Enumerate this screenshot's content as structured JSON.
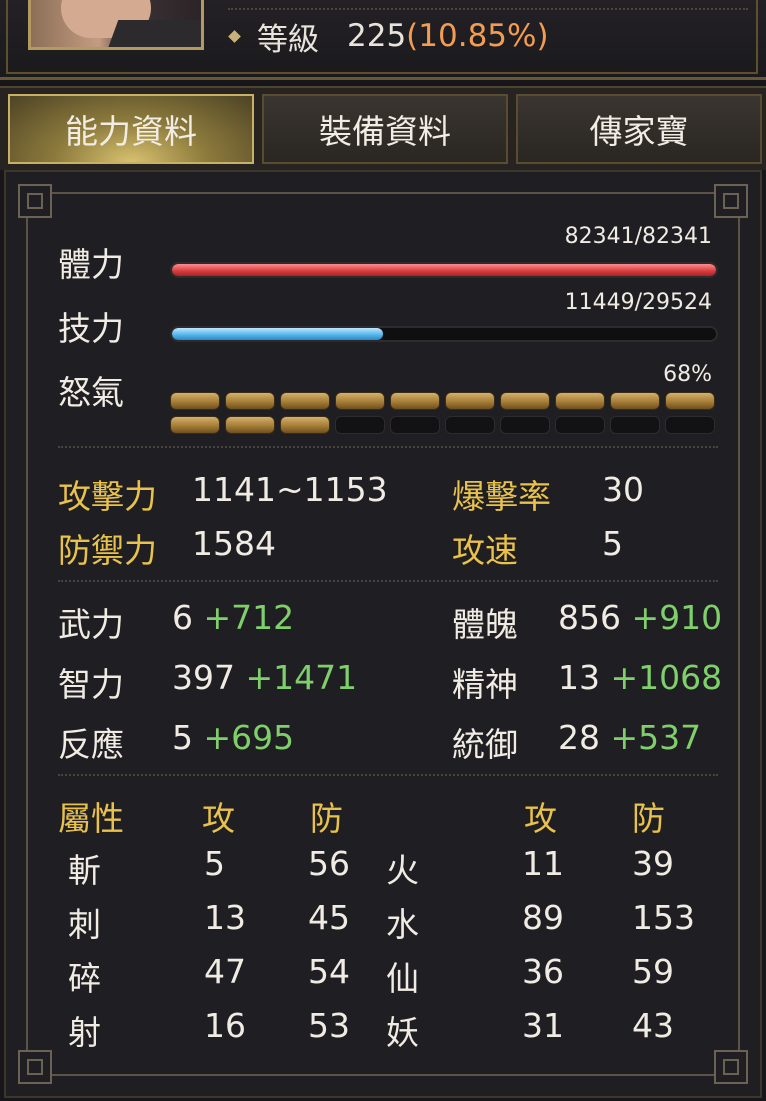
{
  "header": {
    "level_label": "等級",
    "level_value": "225",
    "level_percent": "(10.85%)"
  },
  "tabs": [
    {
      "label": "能力資料",
      "active": true
    },
    {
      "label": "裝備資料",
      "active": false
    },
    {
      "label": "傳家寶",
      "active": false
    }
  ],
  "vitals": {
    "hp": {
      "label": "體力",
      "value": "82341/82341",
      "current": 82341,
      "max": 82341
    },
    "sp": {
      "label": "技力",
      "value": "11449/29524",
      "current": 11449,
      "max": 29524
    },
    "rage": {
      "label": "怒氣",
      "value": "68%",
      "percent": 68,
      "segments_filled": 13,
      "segments_total": 20
    }
  },
  "combat": {
    "attack": {
      "label": "攻擊力",
      "value": "1141~1153"
    },
    "crit": {
      "label": "爆擊率",
      "value": "30"
    },
    "defense": {
      "label": "防禦力",
      "value": "1584"
    },
    "speed": {
      "label": "攻速",
      "value": "5"
    }
  },
  "attributes": [
    {
      "label": "武力",
      "base": "6",
      "bonus": "+712"
    },
    {
      "label": "體魄",
      "base": "856",
      "bonus": "+910"
    },
    {
      "label": "智力",
      "base": "397",
      "bonus": "+1471"
    },
    {
      "label": "精神",
      "base": "13",
      "bonus": "+1068"
    },
    {
      "label": "反應",
      "base": "5",
      "bonus": "+695"
    },
    {
      "label": "統御",
      "base": "28",
      "bonus": "+537"
    }
  ],
  "elements": {
    "header_label": "屬性",
    "atk_header": "攻",
    "def_header": "防",
    "atk_header_2": "攻",
    "def_header_2": "防",
    "rows": [
      {
        "left": "斬",
        "left_atk": "5",
        "left_def": "56",
        "right": "火",
        "right_atk": "11",
        "right_def": "39"
      },
      {
        "left": "刺",
        "left_atk": "13",
        "left_def": "45",
        "right": "水",
        "right_atk": "89",
        "right_def": "153"
      },
      {
        "left": "碎",
        "left_atk": "47",
        "left_def": "54",
        "right": "仙",
        "right_atk": "36",
        "right_def": "59"
      },
      {
        "left": "射",
        "left_atk": "16",
        "left_def": "53",
        "right": "妖",
        "right_atk": "31",
        "right_def": "43"
      }
    ]
  },
  "colors": {
    "gold": "#e9c24b",
    "bonus_green": "#7fcf6a",
    "level_percent": "#f39c52",
    "hp_bar": "#d63a3e",
    "sp_bar": "#4eb3ea",
    "rage_segment": "#a57d36"
  }
}
